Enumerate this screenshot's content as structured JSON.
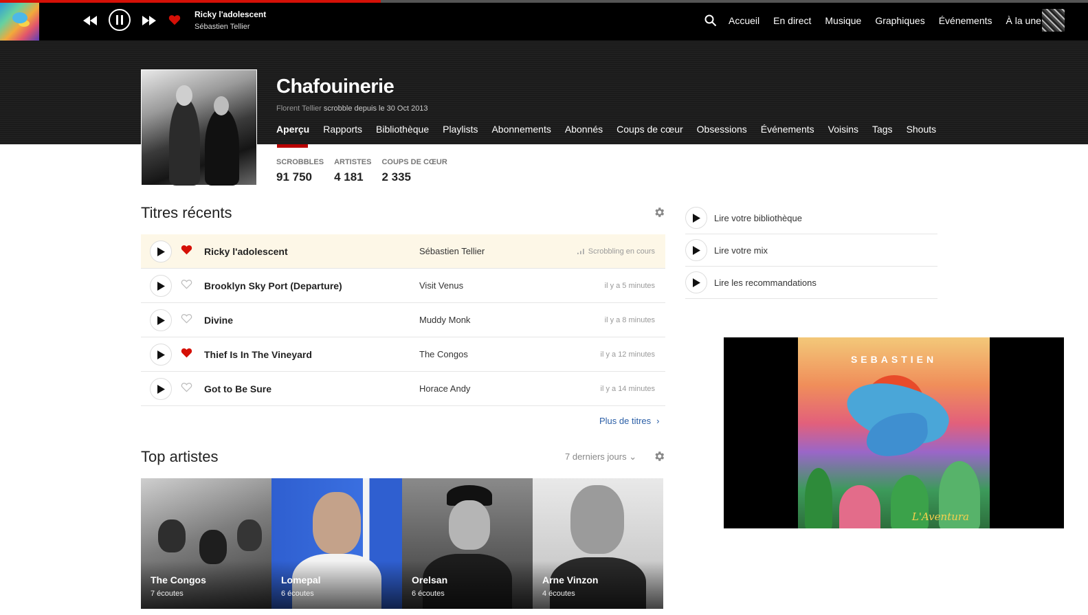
{
  "player": {
    "track_title": "Ricky l'adolescent",
    "track_artist": "Sébastien Tellier",
    "progress_percent": 35,
    "loved": true
  },
  "nav": {
    "items": [
      "Accueil",
      "En direct",
      "Musique",
      "Graphiques",
      "Événements",
      "À la une"
    ]
  },
  "profile": {
    "username": "Chafouinerie",
    "real_name": "Florent Tellier",
    "since_text": "scrobble depuis le 30 Oct 2013",
    "tabs": [
      "Aperçu",
      "Rapports",
      "Bibliothèque",
      "Playlists",
      "Abonnements",
      "Abonnés",
      "Coups de cœur",
      "Obsessions",
      "Événements",
      "Voisins",
      "Tags",
      "Shouts"
    ],
    "stats": [
      {
        "label": "Scrobbles",
        "value": "91 750"
      },
      {
        "label": "Artistes",
        "value": "4 181"
      },
      {
        "label": "Coups de cœur",
        "value": "2 335"
      }
    ]
  },
  "recent": {
    "title": "Titres récents",
    "more_label": "Plus de titres",
    "tracks": [
      {
        "name": "Ricky l'adolescent",
        "artist": "Sébastien Tellier",
        "time": "Scrobbling en cours",
        "loved": true,
        "now": true
      },
      {
        "name": "Brooklyn Sky Port (Departure)",
        "artist": "Visit Venus",
        "time": "il y a 5 minutes",
        "loved": false,
        "now": false
      },
      {
        "name": "Divine",
        "artist": "Muddy Monk",
        "time": "il y a 8 minutes",
        "loved": false,
        "now": false
      },
      {
        "name": "Thief Is In The Vineyard",
        "artist": "The Congos",
        "time": "il y a 12 minutes",
        "loved": true,
        "now": false
      },
      {
        "name": "Got to Be Sure",
        "artist": "Horace Andy",
        "time": "il y a 14 minutes",
        "loved": false,
        "now": false
      }
    ]
  },
  "top_artists": {
    "title": "Top artistes",
    "period": "7 derniers jours",
    "artists": [
      {
        "name": "The Congos",
        "plays": "7 écoutes"
      },
      {
        "name": "Lomepal",
        "plays": "6 écoutes"
      },
      {
        "name": "Orelsan",
        "plays": "6 écoutes"
      },
      {
        "name": "Arne Vinzon",
        "plays": "4 écoutes"
      }
    ]
  },
  "play_actions": [
    "Lire votre bibliothèque",
    "Lire votre mix",
    "Lire les recommandations"
  ],
  "video": {
    "cover_title": "SEBASTIEN",
    "cover_subtitle": "L'Aventura"
  },
  "colors": {
    "accent_red": "#d51007",
    "link_blue": "#2a5ea6",
    "now_playing_bg": "#fdf7e7"
  }
}
